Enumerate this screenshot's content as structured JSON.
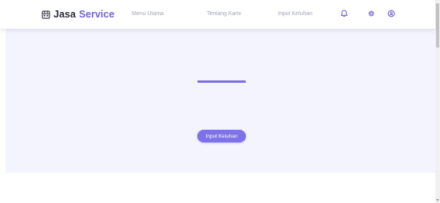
{
  "header": {
    "brand": {
      "name_part1": "Jasa",
      "name_part2": "Service",
      "icon": "building-icon"
    },
    "nav": [
      {
        "label": "Menu Utama"
      },
      {
        "label": "Tentang Kami"
      },
      {
        "label": "Input Keluhan"
      }
    ],
    "icons": [
      "bell-icon",
      "gear-icon",
      "user-icon"
    ]
  },
  "hero": {
    "cta_label": "Input Keluhan"
  },
  "colors": {
    "accent": "#7465d9",
    "cta": "#7d72ea",
    "hero_bg": "#f3f4fd",
    "nav_text": "#a2a6b3"
  }
}
